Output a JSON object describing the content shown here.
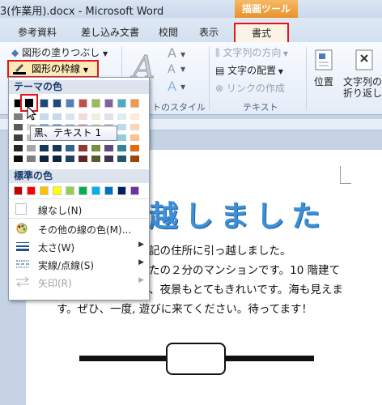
{
  "window": {
    "title": "3(作業用).docx - Microsoft Word",
    "context_tab_group": "描画ツール"
  },
  "tabs": [
    "参考資料",
    "差し込み文書",
    "校閲",
    "表示",
    "書式"
  ],
  "ribbon": {
    "fill_label": "図形の塗りつぶし",
    "outline_label": "図形の枠線",
    "text_direction": "文字列の方向",
    "text_align": "文字の配置",
    "create_link": "リンクの作成",
    "group_text": "テキスト",
    "group_style_tail": "トのスタイル",
    "position": "位置",
    "wrap_line1": "文字列の",
    "wrap_line2": "折り返し"
  },
  "dropdown": {
    "theme_colors_header": "テーマの色",
    "standard_colors_header": "標準の色",
    "no_line": "線なし(N)",
    "more_colors": "その他の線の色(M)...",
    "weight": "太さ(W)",
    "dashes": "実線/点線(S)",
    "arrows": "矢印(R)",
    "theme_top": [
      "#000000",
      "#ffffff",
      "#1f497d",
      "#1f497d",
      "#4f81bd",
      "#c0504d",
      "#9bbb59",
      "#8064a2",
      "#4bacc6",
      "#f79646"
    ],
    "theme_shades": [
      [
        "#7f7f7f",
        "#f2f2f2",
        "#c6d9f0",
        "#c6d9f0",
        "#dbe5f1",
        "#f2dcdb",
        "#ebf1dd",
        "#e5e0ec",
        "#dbeef3",
        "#fdeada"
      ],
      [
        "#595959",
        "#d8d8d8",
        "#8db3e2",
        "#8db3e2",
        "#b8cce4",
        "#e5b9b7",
        "#d7e3bc",
        "#ccc1d9",
        "#b7dde8",
        "#fbd5b5"
      ],
      [
        "#3f3f3f",
        "#bfbfbf",
        "#548dd4",
        "#548dd4",
        "#95b3d7",
        "#d99694",
        "#c3d69b",
        "#b2a2c7",
        "#92cddc",
        "#fac08f"
      ],
      [
        "#262626",
        "#a5a5a5",
        "#17365d",
        "#17365d",
        "#366092",
        "#953734",
        "#76923c",
        "#5f497a",
        "#31859b",
        "#e36c09"
      ],
      [
        "#0c0c0c",
        "#7f7f7f",
        "#0f243e",
        "#0f243e",
        "#244061",
        "#632423",
        "#4f6128",
        "#3f3151",
        "#205867",
        "#974806"
      ]
    ],
    "standard": [
      "#c00000",
      "#ff0000",
      "#ffc000",
      "#ffff00",
      "#92d050",
      "#00b050",
      "#00b0f0",
      "#0070c0",
      "#002060",
      "#7030a0"
    ]
  },
  "tooltip": "黒、テキスト 1",
  "document": {
    "title": "越しました",
    "lines": [
      "記の住所に引っ越しました。",
      "たの２分のマンションです。10 階建て",
      "、夜景もとてもきれいです。海も見えま",
      "す。ぜひ、一度, 遊びに来てください。待ってます！"
    ]
  }
}
